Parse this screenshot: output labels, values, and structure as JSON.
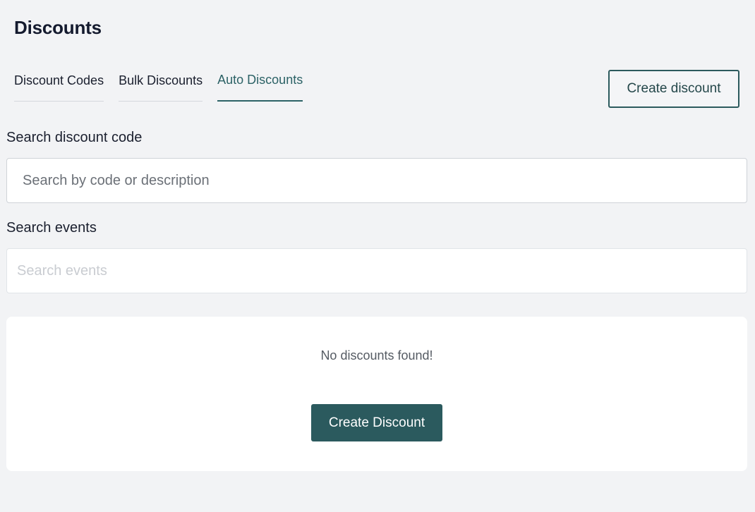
{
  "header": {
    "title": "Discounts",
    "create_button_label": "Create discount"
  },
  "tabs": [
    {
      "label": "Discount Codes",
      "active": false
    },
    {
      "label": "Bulk Discounts",
      "active": false
    },
    {
      "label": "Auto Discounts",
      "active": true
    }
  ],
  "search_code": {
    "label": "Search discount code",
    "placeholder": "Search by code or description",
    "value": ""
  },
  "search_events": {
    "label": "Search events",
    "placeholder": "Search events",
    "value": ""
  },
  "empty_state": {
    "message": "No discounts found!",
    "button_label": "Create Discount"
  },
  "colors": {
    "page_background": "#f2f3f5",
    "accent": "#2b5a5e",
    "active_tab": "#2c6266",
    "card_background": "#ffffff"
  }
}
